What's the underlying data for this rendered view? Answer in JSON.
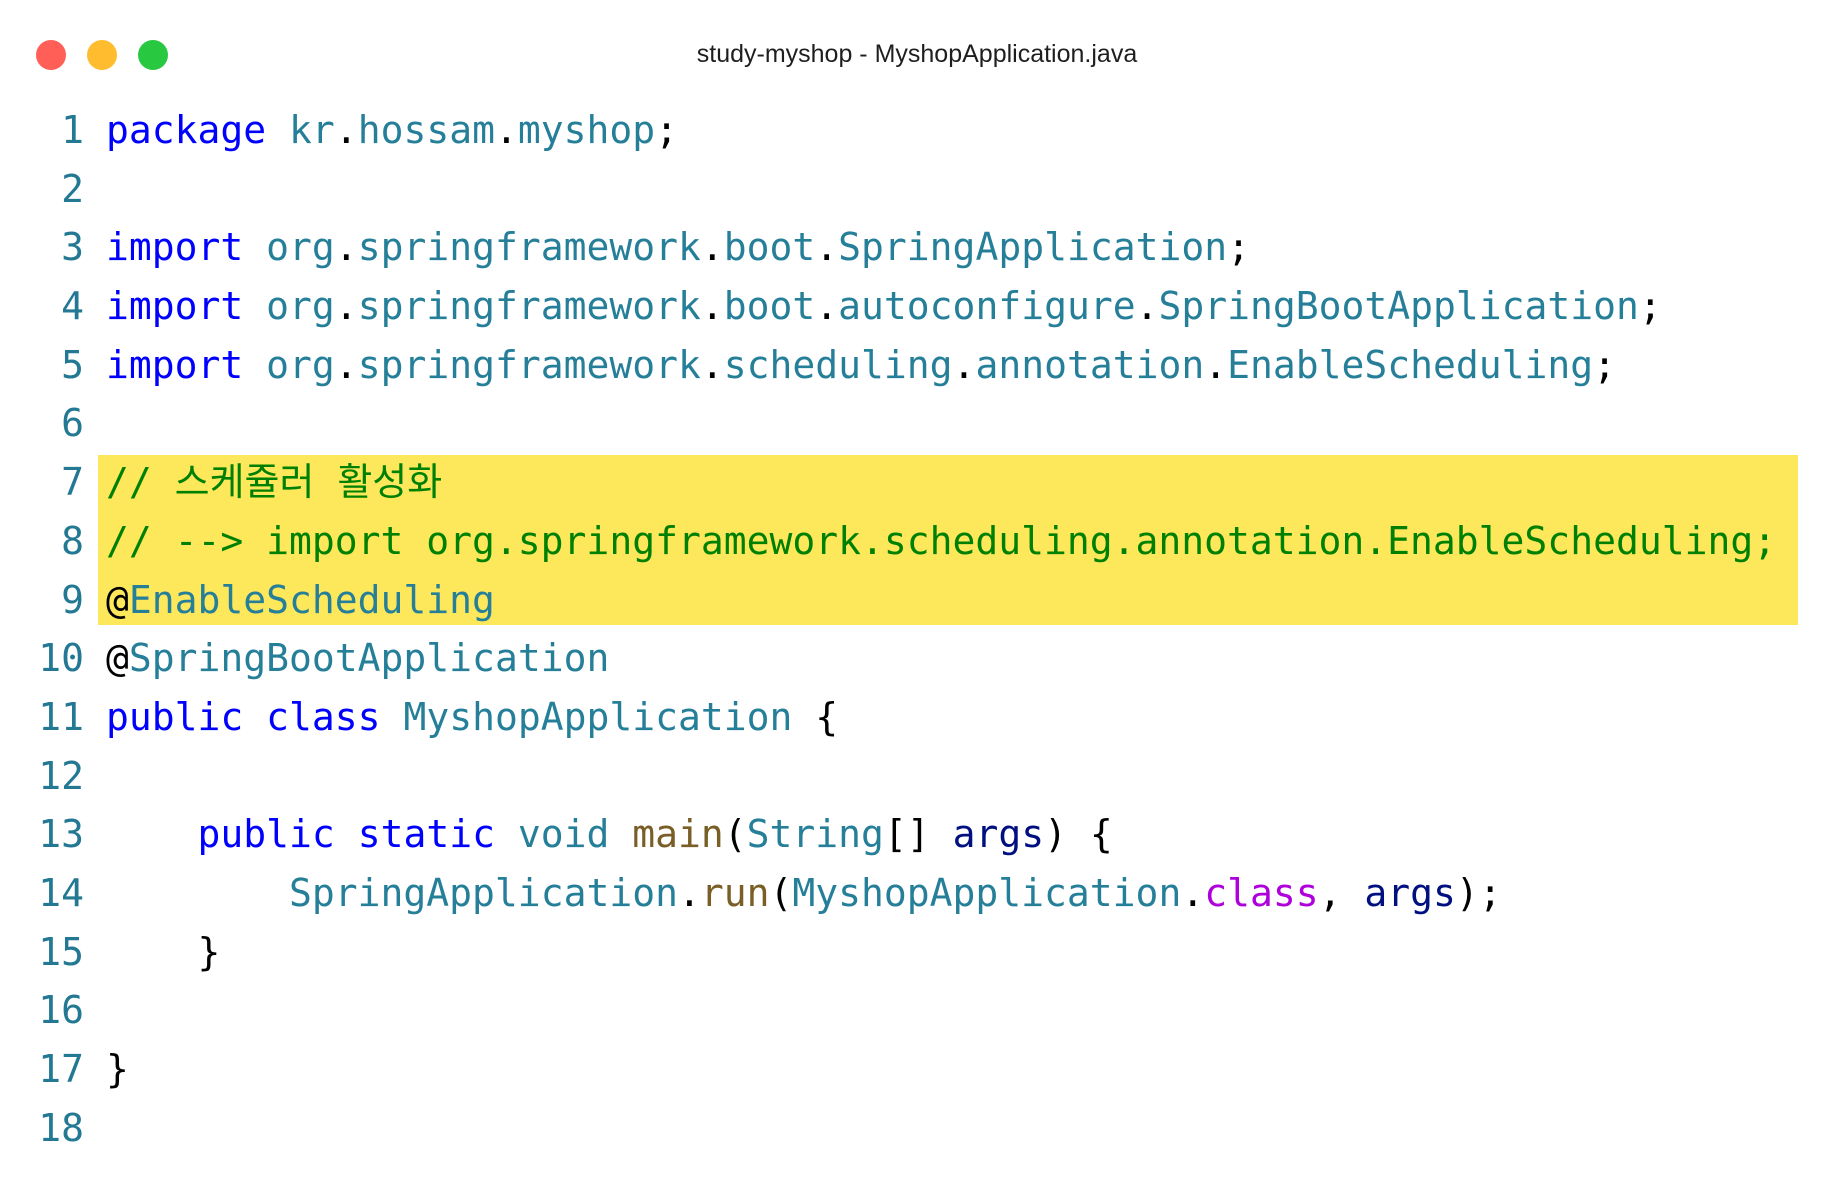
{
  "window": {
    "title": "study-myshop - MyshopApplication.java",
    "traffic_lights": [
      {
        "name": "close",
        "color": "#ff5f57"
      },
      {
        "name": "minimize",
        "color": "#febc2e"
      },
      {
        "name": "zoom",
        "color": "#28c840"
      }
    ]
  },
  "colors": {
    "keyword": "#0000ff",
    "package_ident": "#267f99",
    "type": "#267f99",
    "punctuation": "#000000",
    "comment": "#008000",
    "annotation_at": "#000000",
    "method": "#795e26",
    "param": "#001080",
    "class_literal": "#af00db",
    "line_number": "#237893",
    "highlight": "#fde75a"
  },
  "editor": {
    "highlighted_lines": [
      7,
      8,
      9
    ],
    "lines": [
      {
        "n": "1",
        "tokens": [
          {
            "t": "package",
            "c": "keyword"
          },
          {
            "t": " ",
            "c": "punctuation"
          },
          {
            "t": "kr",
            "c": "package_ident"
          },
          {
            "t": ".",
            "c": "punctuation"
          },
          {
            "t": "hossam",
            "c": "package_ident"
          },
          {
            "t": ".",
            "c": "punctuation"
          },
          {
            "t": "myshop",
            "c": "package_ident"
          },
          {
            "t": ";",
            "c": "punctuation"
          }
        ]
      },
      {
        "n": "2",
        "tokens": []
      },
      {
        "n": "3",
        "tokens": [
          {
            "t": "import",
            "c": "keyword"
          },
          {
            "t": " ",
            "c": "punctuation"
          },
          {
            "t": "org",
            "c": "package_ident"
          },
          {
            "t": ".",
            "c": "punctuation"
          },
          {
            "t": "springframework",
            "c": "package_ident"
          },
          {
            "t": ".",
            "c": "punctuation"
          },
          {
            "t": "boot",
            "c": "package_ident"
          },
          {
            "t": ".",
            "c": "punctuation"
          },
          {
            "t": "SpringApplication",
            "c": "type"
          },
          {
            "t": ";",
            "c": "punctuation"
          }
        ]
      },
      {
        "n": "4",
        "tokens": [
          {
            "t": "import",
            "c": "keyword"
          },
          {
            "t": " ",
            "c": "punctuation"
          },
          {
            "t": "org",
            "c": "package_ident"
          },
          {
            "t": ".",
            "c": "punctuation"
          },
          {
            "t": "springframework",
            "c": "package_ident"
          },
          {
            "t": ".",
            "c": "punctuation"
          },
          {
            "t": "boot",
            "c": "package_ident"
          },
          {
            "t": ".",
            "c": "punctuation"
          },
          {
            "t": "autoconfigure",
            "c": "package_ident"
          },
          {
            "t": ".",
            "c": "punctuation"
          },
          {
            "t": "SpringBootApplication",
            "c": "type"
          },
          {
            "t": ";",
            "c": "punctuation"
          }
        ]
      },
      {
        "n": "5",
        "tokens": [
          {
            "t": "import",
            "c": "keyword"
          },
          {
            "t": " ",
            "c": "punctuation"
          },
          {
            "t": "org",
            "c": "package_ident"
          },
          {
            "t": ".",
            "c": "punctuation"
          },
          {
            "t": "springframework",
            "c": "package_ident"
          },
          {
            "t": ".",
            "c": "punctuation"
          },
          {
            "t": "scheduling",
            "c": "package_ident"
          },
          {
            "t": ".",
            "c": "punctuation"
          },
          {
            "t": "annotation",
            "c": "package_ident"
          },
          {
            "t": ".",
            "c": "punctuation"
          },
          {
            "t": "EnableScheduling",
            "c": "type"
          },
          {
            "t": ";",
            "c": "punctuation"
          }
        ]
      },
      {
        "n": "6",
        "tokens": []
      },
      {
        "n": "7",
        "tokens": [
          {
            "t": "// 스케쥴러 활성화",
            "c": "comment"
          }
        ]
      },
      {
        "n": "8",
        "tokens": [
          {
            "t": "// --> import org.springframework.scheduling.annotation.EnableScheduling;",
            "c": "comment"
          }
        ]
      },
      {
        "n": "9",
        "tokens": [
          {
            "t": "@",
            "c": "annotation_at"
          },
          {
            "t": "EnableScheduling",
            "c": "type"
          }
        ]
      },
      {
        "n": "10",
        "tokens": [
          {
            "t": "@",
            "c": "annotation_at"
          },
          {
            "t": "SpringBootApplication",
            "c": "type"
          }
        ]
      },
      {
        "n": "11",
        "tokens": [
          {
            "t": "public",
            "c": "keyword"
          },
          {
            "t": " ",
            "c": "punctuation"
          },
          {
            "t": "class",
            "c": "keyword"
          },
          {
            "t": " ",
            "c": "punctuation"
          },
          {
            "t": "MyshopApplication",
            "c": "type"
          },
          {
            "t": " {",
            "c": "punctuation"
          }
        ]
      },
      {
        "n": "12",
        "tokens": []
      },
      {
        "n": "13",
        "tokens": [
          {
            "t": "    ",
            "c": "punctuation"
          },
          {
            "t": "public",
            "c": "keyword"
          },
          {
            "t": " ",
            "c": "punctuation"
          },
          {
            "t": "static",
            "c": "keyword"
          },
          {
            "t": " ",
            "c": "punctuation"
          },
          {
            "t": "void",
            "c": "type"
          },
          {
            "t": " ",
            "c": "punctuation"
          },
          {
            "t": "main",
            "c": "method"
          },
          {
            "t": "(",
            "c": "punctuation"
          },
          {
            "t": "String",
            "c": "type"
          },
          {
            "t": "[] ",
            "c": "punctuation"
          },
          {
            "t": "args",
            "c": "param"
          },
          {
            "t": ") {",
            "c": "punctuation"
          }
        ]
      },
      {
        "n": "14",
        "tokens": [
          {
            "t": "        ",
            "c": "punctuation"
          },
          {
            "t": "SpringApplication",
            "c": "type"
          },
          {
            "t": ".",
            "c": "punctuation"
          },
          {
            "t": "run",
            "c": "method"
          },
          {
            "t": "(",
            "c": "punctuation"
          },
          {
            "t": "MyshopApplication",
            "c": "type"
          },
          {
            "t": ".",
            "c": "punctuation"
          },
          {
            "t": "class",
            "c": "class_literal"
          },
          {
            "t": ", ",
            "c": "punctuation"
          },
          {
            "t": "args",
            "c": "param"
          },
          {
            "t": ");",
            "c": "punctuation"
          }
        ]
      },
      {
        "n": "15",
        "tokens": [
          {
            "t": "    }",
            "c": "punctuation"
          }
        ]
      },
      {
        "n": "16",
        "tokens": []
      },
      {
        "n": "17",
        "tokens": [
          {
            "t": "}",
            "c": "punctuation"
          }
        ]
      },
      {
        "n": "18",
        "tokens": []
      }
    ]
  }
}
